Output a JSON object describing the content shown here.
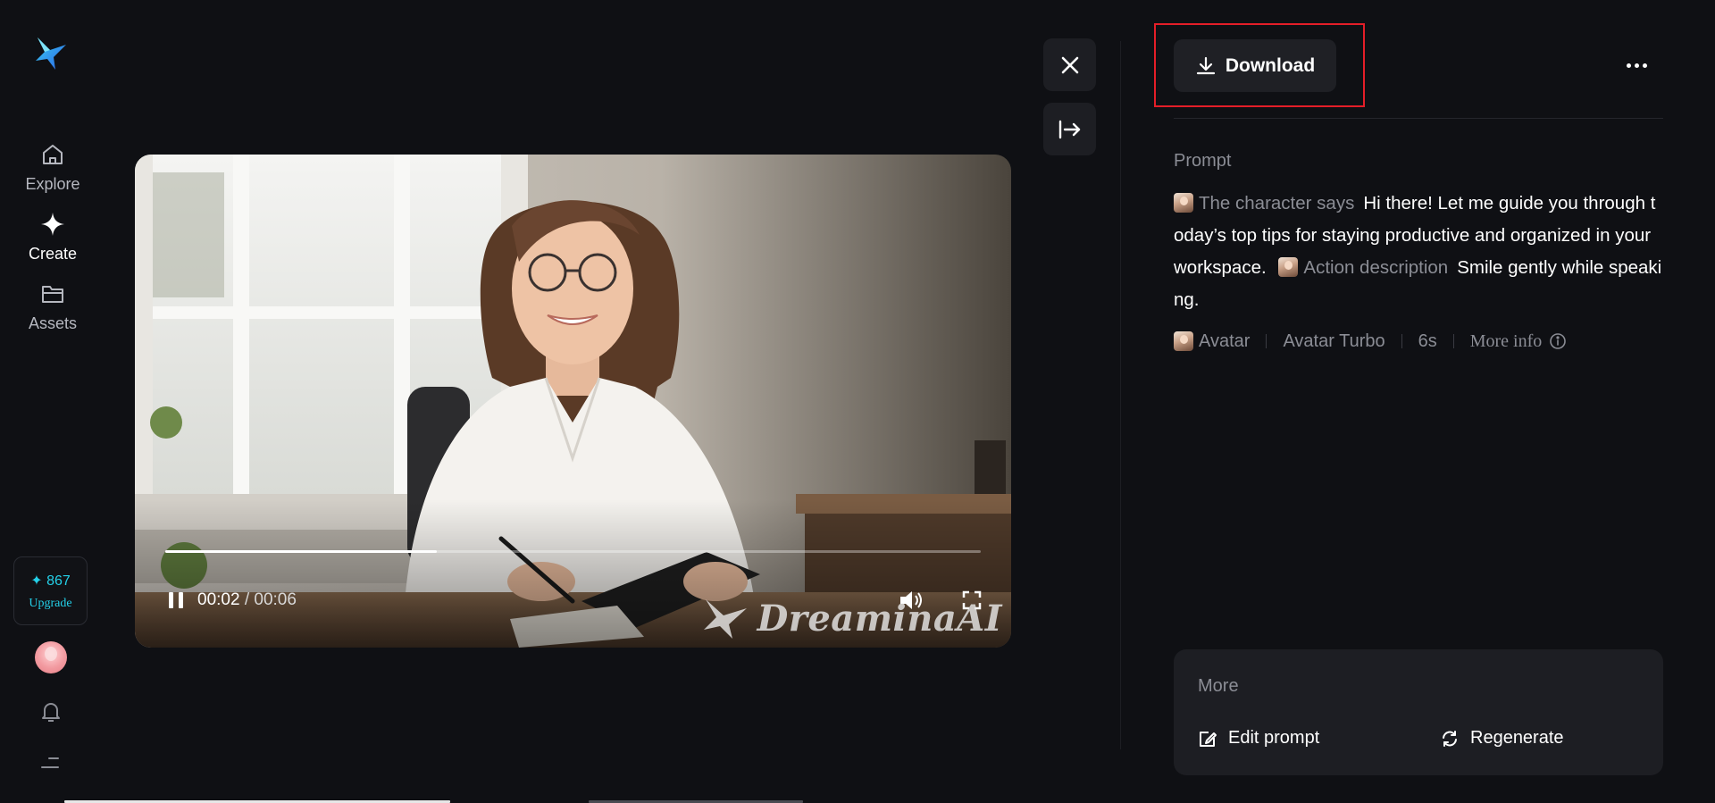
{
  "sidebar": {
    "nav": [
      {
        "label": "Explore",
        "icon": "home-icon"
      },
      {
        "label": "Create",
        "icon": "sparkle-icon"
      },
      {
        "label": "Assets",
        "icon": "folder-icon"
      }
    ],
    "credits": {
      "count": "867",
      "upgrade_label": "Upgrade"
    }
  },
  "video": {
    "time_current": "00:02",
    "time_separator": "/",
    "time_total": "00:06",
    "progress_fraction": 0.333,
    "watermark": "DreaminaAI"
  },
  "panel": {
    "download_label": "Download",
    "prompt_title": "Prompt",
    "prompt_segments": [
      {
        "chip": "The character says",
        "text": "Hi there! Let me guide you through today’s top tips for staying productive and organized in your workspace."
      },
      {
        "chip": "Action description",
        "text": "Smile gently while speaking."
      }
    ],
    "meta": {
      "avatar_label": "Avatar",
      "model": "Avatar Turbo",
      "duration": "6s",
      "more_info": "More info"
    },
    "more": {
      "title": "More",
      "edit_prompt": "Edit prompt",
      "regenerate": "Regenerate"
    }
  },
  "colors": {
    "background": "#0f1014",
    "accent_cyan": "#24d0e8",
    "highlight_red": "#e41e28"
  }
}
